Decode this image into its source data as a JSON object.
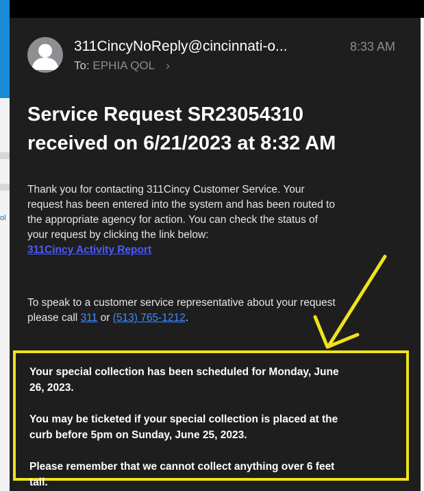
{
  "email": {
    "from": "311CincyNoReply@cincinnati-o...",
    "time": "8:33 AM",
    "to_label": "To:",
    "to_value": "EPHIA QOL",
    "to_chevron": "›",
    "subject_line1": "Service Request SR23054310",
    "subject_line2": "received on 6/21/2023 at 8:32 AM",
    "body": {
      "p1_line1": "Thank you for contacting 311Cincy Customer Service. Your",
      "p1_line2": "request has been entered into the system and has been routed to",
      "p1_line3": "the appropriate agency for action. You can check the status of",
      "p1_line4": "your request by clicking the link below:",
      "activity_link": "311Cincy Activity Report",
      "p2_line1": "To speak to a customer service representative about your request",
      "p2_prefix": "please call",
      "phone_311": "311",
      "or_text": "or",
      "phone_number": "(513) 765-1212",
      "period": "."
    },
    "notice": {
      "line1": "Your special collection has been scheduled for Monday, June",
      "line2": "26, 2023.",
      "line3": "You may be ticketed if your special collection is placed at the",
      "line4": "curb before 5pm on Sunday, June 25, 2023.",
      "line5": "Please remember that we cannot collect anything over 6 feet",
      "line6": "tall."
    }
  },
  "annotation": {
    "arrow_color": "#f0e21c",
    "box_color": "#f0e21c"
  },
  "icons": {
    "avatar": "person-icon",
    "chevron": "chevron-right-icon",
    "arrow": "arrow-icon"
  },
  "background": {
    "edge_text": "ol"
  }
}
